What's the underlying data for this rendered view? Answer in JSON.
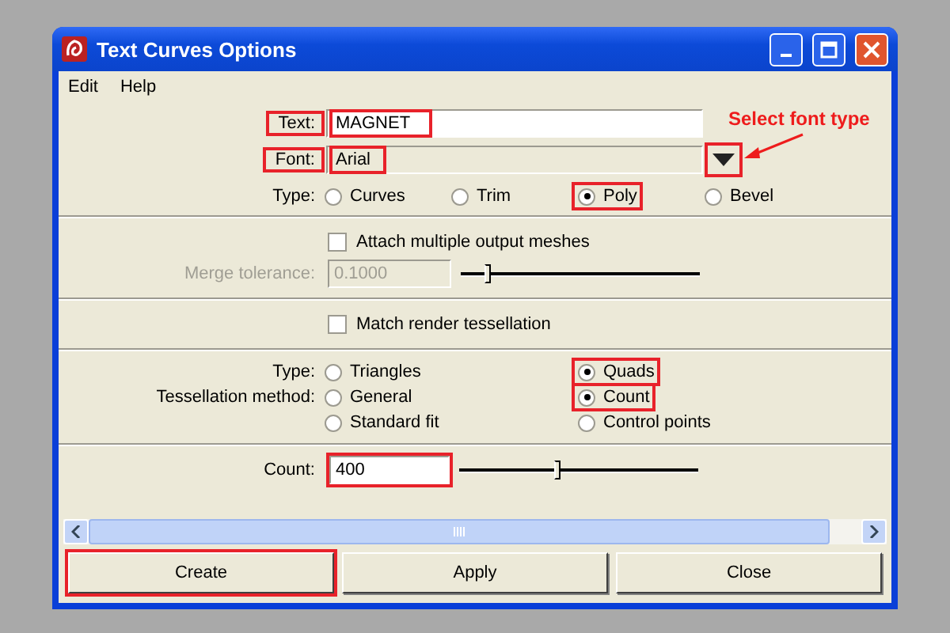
{
  "window": {
    "title": "Text Curves Options"
  },
  "menu": [
    "Edit",
    "Help"
  ],
  "text_field": {
    "label": "Text:",
    "value": "MAGNET",
    "highlighted": true
  },
  "font_field": {
    "label": "Font:",
    "value": "Arial",
    "highlighted": true,
    "dropdown_highlighted": true
  },
  "annotation": {
    "text": "Select font type"
  },
  "type_options": {
    "label": "Type:",
    "options": [
      {
        "label": "Curves",
        "selected": false,
        "highlighted": false
      },
      {
        "label": "Trim",
        "selected": false,
        "highlighted": false
      },
      {
        "label": "Poly",
        "selected": true,
        "highlighted": true
      },
      {
        "label": "Bevel",
        "selected": false,
        "highlighted": false
      }
    ]
  },
  "attach_meshes": {
    "label": "Attach multiple output meshes",
    "checked": false
  },
  "merge_tolerance": {
    "label": "Merge tolerance:",
    "value": "0.1000",
    "disabled": true,
    "level": 0.1
  },
  "match_render": {
    "label": "Match render tessellation",
    "checked": false
  },
  "tessellation": {
    "type_label": "Type:",
    "method_label": "Tessellation method:",
    "type_options": [
      {
        "label": "Triangles",
        "selected": false,
        "highlighted": false
      },
      {
        "label": "Quads",
        "selected": true,
        "highlighted": true
      }
    ],
    "method_options": [
      {
        "label": "General",
        "selected": false,
        "highlighted": false
      },
      {
        "label": "Standard fit",
        "selected": false,
        "highlighted": false
      },
      {
        "label": "Count",
        "selected": true,
        "highlighted": true
      },
      {
        "label": "Control points",
        "selected": false,
        "highlighted": false
      }
    ]
  },
  "count": {
    "label": "Count:",
    "value": "400",
    "highlighted": true,
    "level": 0.41
  },
  "buttons": [
    {
      "label": "Create",
      "highlighted": true
    },
    {
      "label": "Apply",
      "highlighted": false
    },
    {
      "label": "Close",
      "highlighted": false
    }
  ]
}
